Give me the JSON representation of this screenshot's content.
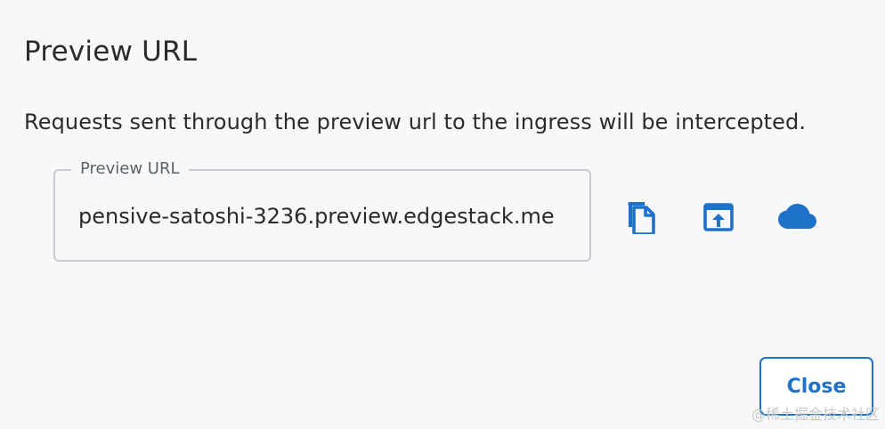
{
  "dialog": {
    "title": "Preview URL",
    "message": "Requests sent through the preview url to the ingress will be intercepted."
  },
  "preview_field": {
    "label": "Preview URL",
    "value": "pensive-satoshi-3236.preview.edgestack.me"
  },
  "actions": {
    "copy_icon": "copy-icon",
    "open_icon": "open-in-browser-icon",
    "cloud_icon": "cloud-icon",
    "close_label": "Close"
  },
  "watermark": "@稀土掘金技术社区",
  "colors": {
    "accent": "#1f72c9",
    "text": "#2b2b2b",
    "border": "#c9cbce",
    "background": "#f7f8f9"
  }
}
